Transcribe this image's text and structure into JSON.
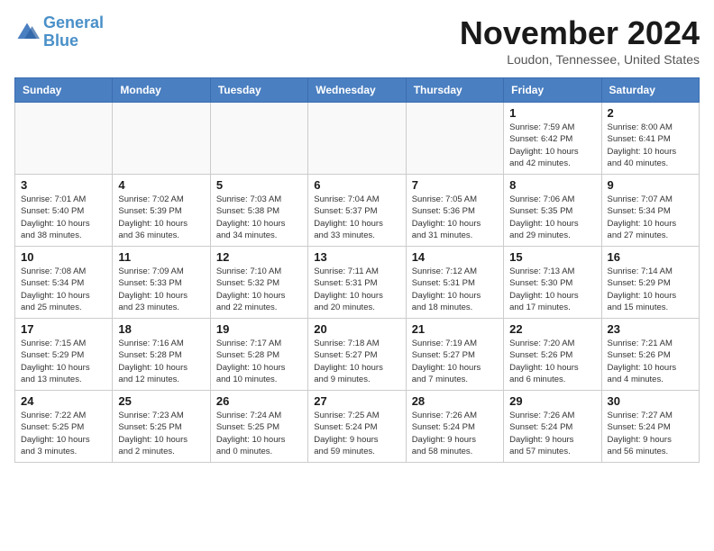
{
  "header": {
    "logo_line1": "General",
    "logo_line2": "Blue",
    "month": "November 2024",
    "location": "Loudon, Tennessee, United States"
  },
  "weekdays": [
    "Sunday",
    "Monday",
    "Tuesday",
    "Wednesday",
    "Thursday",
    "Friday",
    "Saturday"
  ],
  "weeks": [
    [
      {
        "day": "",
        "info": ""
      },
      {
        "day": "",
        "info": ""
      },
      {
        "day": "",
        "info": ""
      },
      {
        "day": "",
        "info": ""
      },
      {
        "day": "",
        "info": ""
      },
      {
        "day": "1",
        "info": "Sunrise: 7:59 AM\nSunset: 6:42 PM\nDaylight: 10 hours\nand 42 minutes."
      },
      {
        "day": "2",
        "info": "Sunrise: 8:00 AM\nSunset: 6:41 PM\nDaylight: 10 hours\nand 40 minutes."
      }
    ],
    [
      {
        "day": "3",
        "info": "Sunrise: 7:01 AM\nSunset: 5:40 PM\nDaylight: 10 hours\nand 38 minutes."
      },
      {
        "day": "4",
        "info": "Sunrise: 7:02 AM\nSunset: 5:39 PM\nDaylight: 10 hours\nand 36 minutes."
      },
      {
        "day": "5",
        "info": "Sunrise: 7:03 AM\nSunset: 5:38 PM\nDaylight: 10 hours\nand 34 minutes."
      },
      {
        "day": "6",
        "info": "Sunrise: 7:04 AM\nSunset: 5:37 PM\nDaylight: 10 hours\nand 33 minutes."
      },
      {
        "day": "7",
        "info": "Sunrise: 7:05 AM\nSunset: 5:36 PM\nDaylight: 10 hours\nand 31 minutes."
      },
      {
        "day": "8",
        "info": "Sunrise: 7:06 AM\nSunset: 5:35 PM\nDaylight: 10 hours\nand 29 minutes."
      },
      {
        "day": "9",
        "info": "Sunrise: 7:07 AM\nSunset: 5:34 PM\nDaylight: 10 hours\nand 27 minutes."
      }
    ],
    [
      {
        "day": "10",
        "info": "Sunrise: 7:08 AM\nSunset: 5:34 PM\nDaylight: 10 hours\nand 25 minutes."
      },
      {
        "day": "11",
        "info": "Sunrise: 7:09 AM\nSunset: 5:33 PM\nDaylight: 10 hours\nand 23 minutes."
      },
      {
        "day": "12",
        "info": "Sunrise: 7:10 AM\nSunset: 5:32 PM\nDaylight: 10 hours\nand 22 minutes."
      },
      {
        "day": "13",
        "info": "Sunrise: 7:11 AM\nSunset: 5:31 PM\nDaylight: 10 hours\nand 20 minutes."
      },
      {
        "day": "14",
        "info": "Sunrise: 7:12 AM\nSunset: 5:31 PM\nDaylight: 10 hours\nand 18 minutes."
      },
      {
        "day": "15",
        "info": "Sunrise: 7:13 AM\nSunset: 5:30 PM\nDaylight: 10 hours\nand 17 minutes."
      },
      {
        "day": "16",
        "info": "Sunrise: 7:14 AM\nSunset: 5:29 PM\nDaylight: 10 hours\nand 15 minutes."
      }
    ],
    [
      {
        "day": "17",
        "info": "Sunrise: 7:15 AM\nSunset: 5:29 PM\nDaylight: 10 hours\nand 13 minutes."
      },
      {
        "day": "18",
        "info": "Sunrise: 7:16 AM\nSunset: 5:28 PM\nDaylight: 10 hours\nand 12 minutes."
      },
      {
        "day": "19",
        "info": "Sunrise: 7:17 AM\nSunset: 5:28 PM\nDaylight: 10 hours\nand 10 minutes."
      },
      {
        "day": "20",
        "info": "Sunrise: 7:18 AM\nSunset: 5:27 PM\nDaylight: 10 hours\nand 9 minutes."
      },
      {
        "day": "21",
        "info": "Sunrise: 7:19 AM\nSunset: 5:27 PM\nDaylight: 10 hours\nand 7 minutes."
      },
      {
        "day": "22",
        "info": "Sunrise: 7:20 AM\nSunset: 5:26 PM\nDaylight: 10 hours\nand 6 minutes."
      },
      {
        "day": "23",
        "info": "Sunrise: 7:21 AM\nSunset: 5:26 PM\nDaylight: 10 hours\nand 4 minutes."
      }
    ],
    [
      {
        "day": "24",
        "info": "Sunrise: 7:22 AM\nSunset: 5:25 PM\nDaylight: 10 hours\nand 3 minutes."
      },
      {
        "day": "25",
        "info": "Sunrise: 7:23 AM\nSunset: 5:25 PM\nDaylight: 10 hours\nand 2 minutes."
      },
      {
        "day": "26",
        "info": "Sunrise: 7:24 AM\nSunset: 5:25 PM\nDaylight: 10 hours\nand 0 minutes."
      },
      {
        "day": "27",
        "info": "Sunrise: 7:25 AM\nSunset: 5:24 PM\nDaylight: 9 hours\nand 59 minutes."
      },
      {
        "day": "28",
        "info": "Sunrise: 7:26 AM\nSunset: 5:24 PM\nDaylight: 9 hours\nand 58 minutes."
      },
      {
        "day": "29",
        "info": "Sunrise: 7:26 AM\nSunset: 5:24 PM\nDaylight: 9 hours\nand 57 minutes."
      },
      {
        "day": "30",
        "info": "Sunrise: 7:27 AM\nSunset: 5:24 PM\nDaylight: 9 hours\nand 56 minutes."
      }
    ]
  ]
}
